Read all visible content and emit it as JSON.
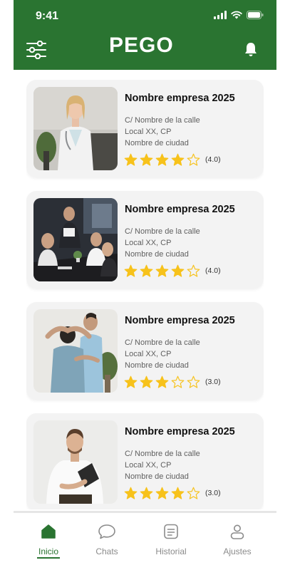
{
  "status_bar": {
    "time": "9:41"
  },
  "header": {
    "logo": "PEGO"
  },
  "colors": {
    "brand_green": "#2a7431",
    "star": "#f7c21b",
    "card_bg": "#f3f3f3"
  },
  "cards": [
    {
      "title": "Nombre empresa 2025",
      "street": "C/ Nombre de la calle",
      "local": "Local XX, CP",
      "city": "Nombre de ciudad",
      "rating": 4,
      "rating_label": "(4.0)"
    },
    {
      "title": "Nombre empresa 2025",
      "street": "C/ Nombre de la calle",
      "local": "Local XX, CP",
      "city": "Nombre de ciudad",
      "rating": 4,
      "rating_label": "(4.0)"
    },
    {
      "title": "Nombre empresa 2025",
      "street": "C/ Nombre de la calle",
      "local": "Local XX, CP",
      "city": "Nombre de ciudad",
      "rating": 3,
      "rating_label": "(3.0)"
    },
    {
      "title": "Nombre empresa 2025",
      "street": "C/ Nombre de la calle",
      "local": "Local XX, CP",
      "city": "Nombre de ciudad",
      "rating": 4,
      "rating_label": "(3.0)"
    }
  ],
  "tabs": [
    {
      "label": "Inicio",
      "icon": "home-icon",
      "active": true
    },
    {
      "label": "Chats",
      "icon": "chat-icon",
      "active": false
    },
    {
      "label": "Historial",
      "icon": "history-icon",
      "active": false
    },
    {
      "label": "Ajustes",
      "icon": "user-icon",
      "active": false
    }
  ]
}
